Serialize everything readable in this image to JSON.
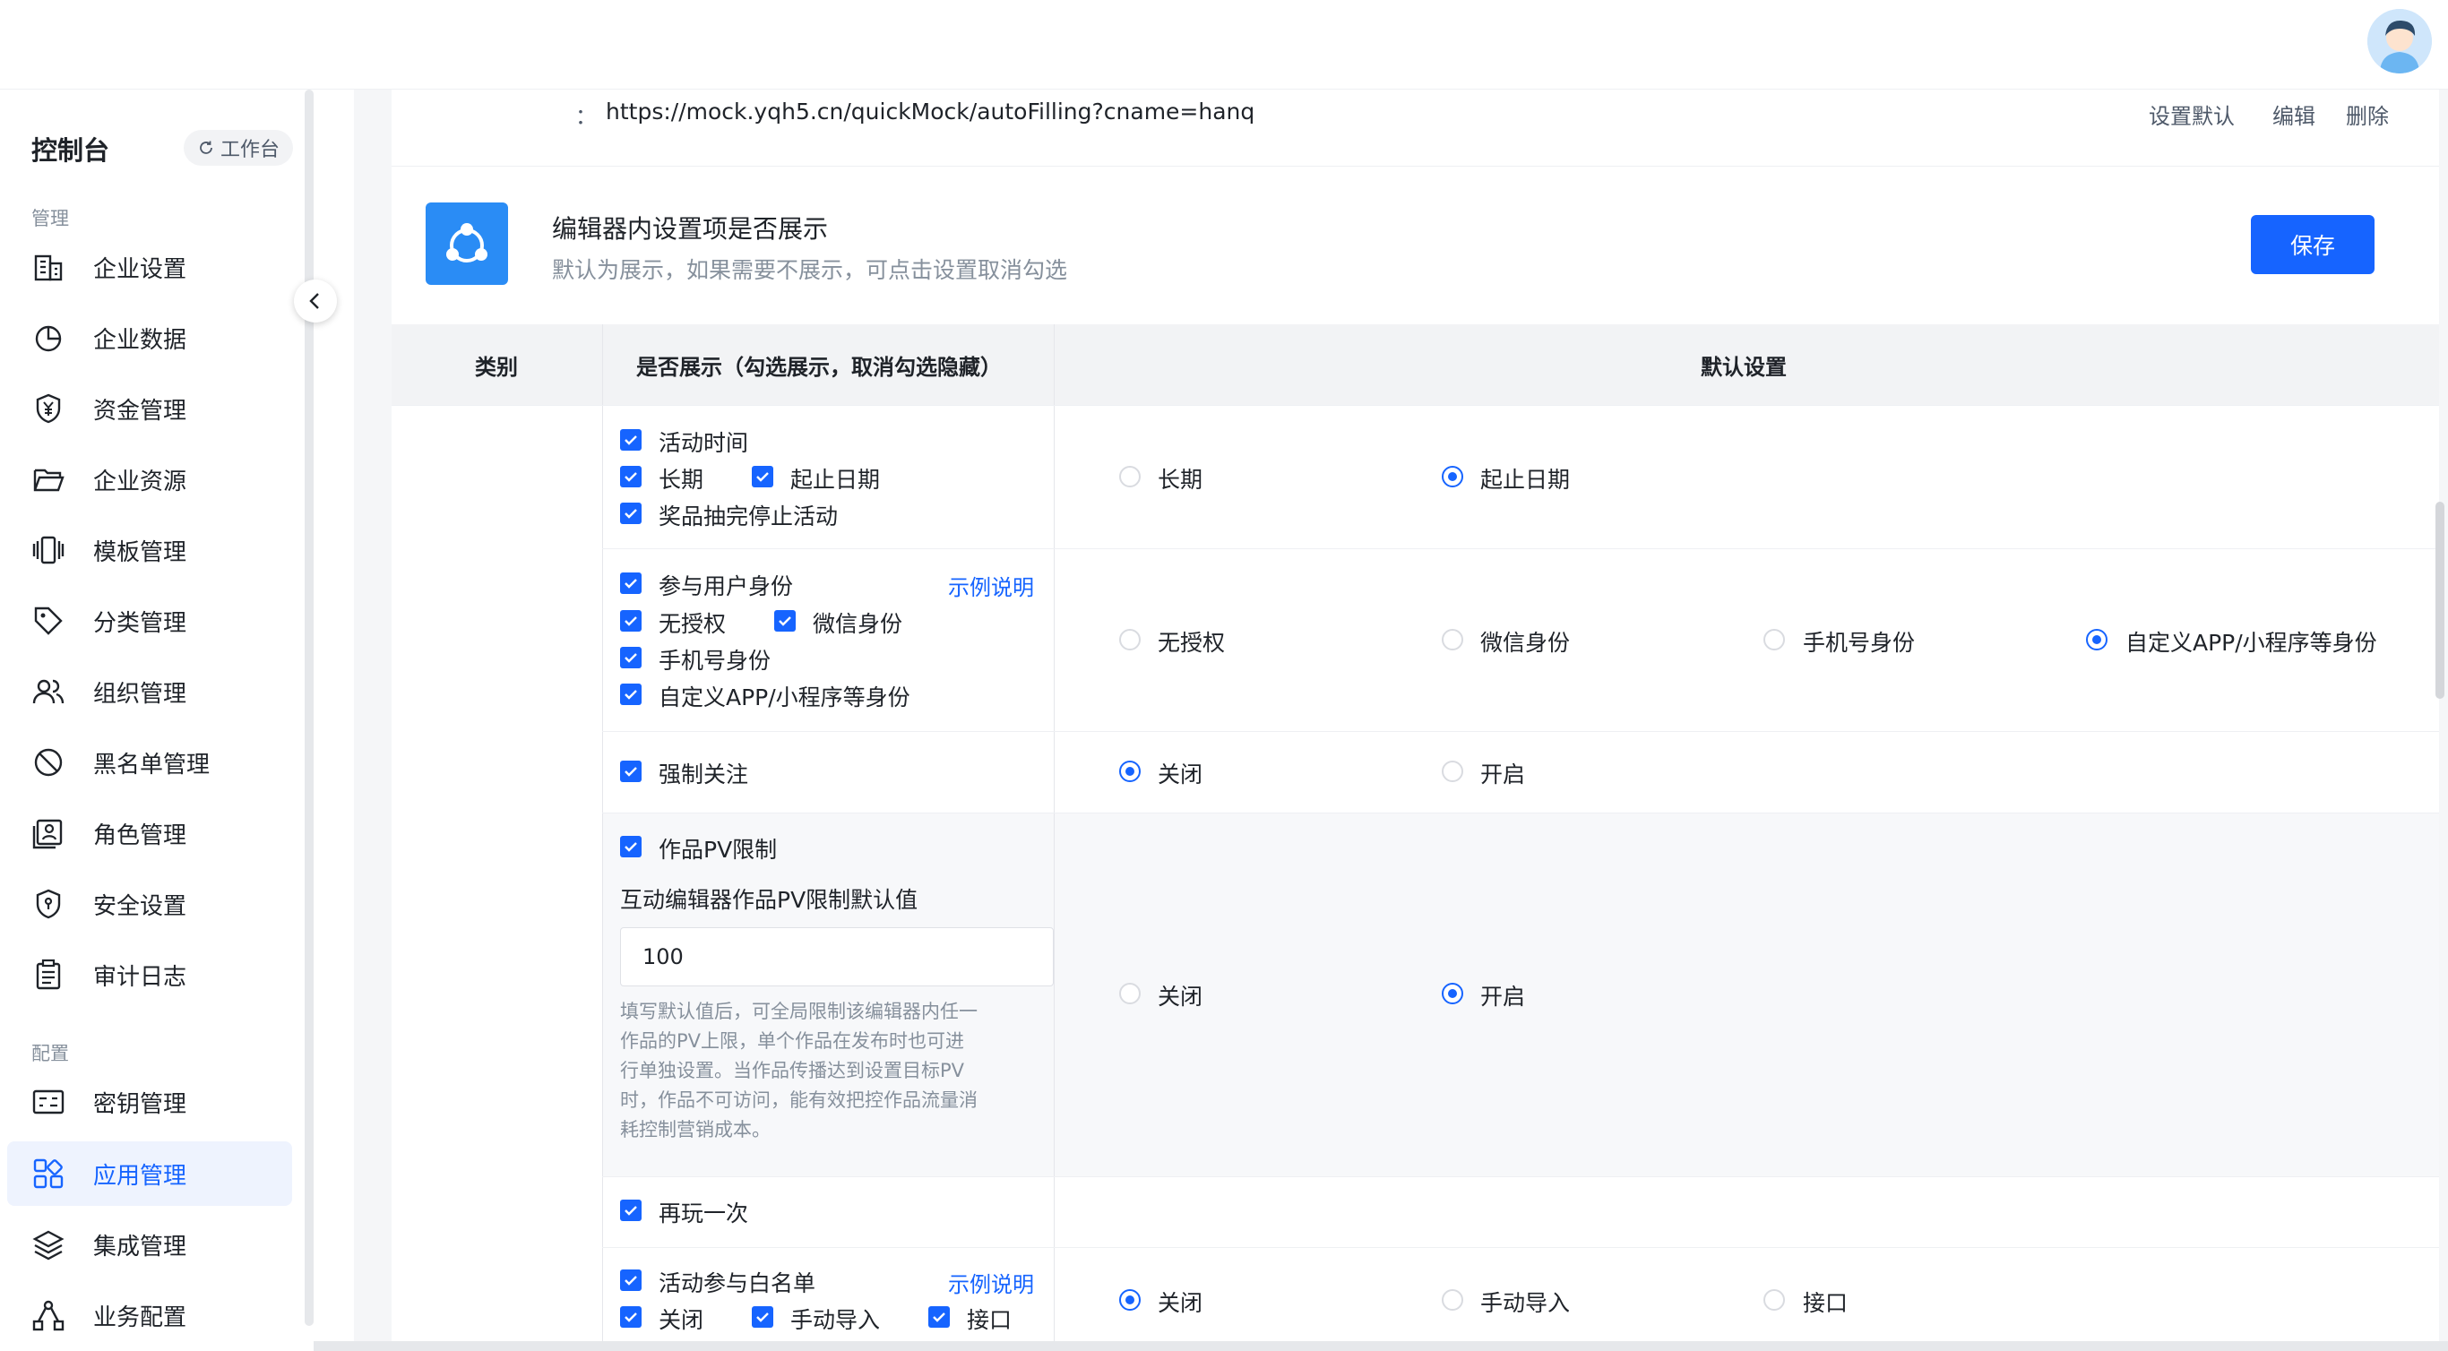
{
  "sidebar": {
    "title": "控制台",
    "workbench_label": "工作台",
    "groups": [
      {
        "label": "管理"
      },
      {
        "label": "配置"
      }
    ],
    "items": [
      {
        "label": "企业设置",
        "icon": "building-icon"
      },
      {
        "label": "企业数据",
        "icon": "pie-chart-icon"
      },
      {
        "label": "资金管理",
        "icon": "yuan-shield-icon"
      },
      {
        "label": "企业资源",
        "icon": "folder-open-icon"
      },
      {
        "label": "模板管理",
        "icon": "template-icon"
      },
      {
        "label": "分类管理",
        "icon": "tag-icon"
      },
      {
        "label": "组织管理",
        "icon": "users-icon"
      },
      {
        "label": "黑名单管理",
        "icon": "ban-icon"
      },
      {
        "label": "角色管理",
        "icon": "role-card-icon"
      },
      {
        "label": "安全设置",
        "icon": "security-shield-icon"
      },
      {
        "label": "审计日志",
        "icon": "clipboard-icon"
      },
      {
        "label": "密钥管理",
        "icon": "key-card-icon"
      },
      {
        "label": "应用管理",
        "icon": "apps-grid-icon",
        "active": true
      },
      {
        "label": "集成管理",
        "icon": "layers-icon"
      },
      {
        "label": "业务配置",
        "icon": "flow-icon"
      }
    ]
  },
  "url_row": {
    "colon": "：",
    "url": "https://mock.yqh5.cn/quickMock/autoFilling?cname=hanq",
    "actions": [
      "设置默认",
      "编辑",
      "删除"
    ]
  },
  "section": {
    "title": "编辑器内设置项是否展示",
    "subtitle": "默认为展示，如果需要不展示，可点击设置取消勾选",
    "save_label": "保存"
  },
  "table": {
    "headers": [
      "类别",
      "是否展示（勾选展示，取消勾选隐藏）",
      "默认设置"
    ],
    "rows": [
      {
        "checks": [
          "活动时间",
          "长期",
          "起止日期",
          "奖品抽完停止活动"
        ],
        "radios": [
          "长期",
          "起止日期"
        ],
        "selected": 1
      },
      {
        "checks": [
          "参与用户身份",
          "无授权",
          "微信身份",
          "手机号身份",
          "自定义APP/小程序等身份"
        ],
        "link": "示例说明",
        "radios": [
          "无授权",
          "微信身份",
          "手机号身份",
          "自定义APP/小程序等身份"
        ],
        "selected": 3
      },
      {
        "checks": [
          "强制关注"
        ],
        "radios": [
          "关闭",
          "开启"
        ],
        "selected": 0
      },
      {
        "checks": [
          "作品PV限制"
        ],
        "subtitle": "互动编辑器作品PV限制默认值",
        "input_value": "100",
        "help": "填写默认值后，可全局限制该编辑器内任一作品的PV上限，单个作品在发布时也可进行单独设置。当作品传播达到设置目标PV时，作品不可访问，能有效把控作品流量消耗控制营销成本。",
        "radios": [
          "关闭",
          "开启"
        ],
        "selected": 1
      },
      {
        "checks": [
          "再玩一次"
        ]
      },
      {
        "checks": [
          "活动参与白名单",
          "关闭",
          "手动导入",
          "接口"
        ],
        "link": "示例说明",
        "radios": [
          "关闭",
          "手动导入",
          "接口"
        ],
        "selected": 0
      }
    ]
  }
}
